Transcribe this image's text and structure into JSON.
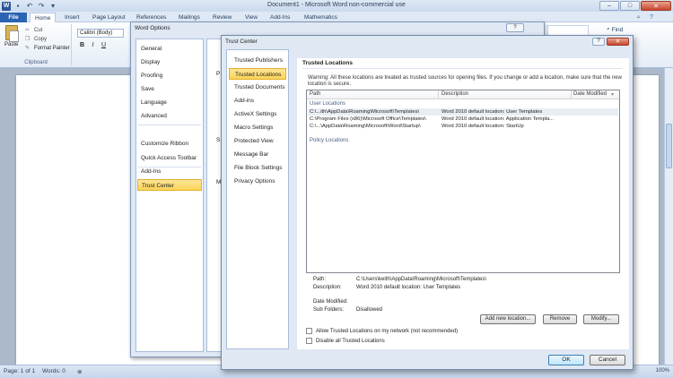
{
  "word": {
    "title": "Document1 - Microsoft Word non-commercial use",
    "tabs": [
      "File",
      "Home",
      "Insert",
      "Page Layout",
      "References",
      "Mailings",
      "Review",
      "View",
      "Add-Ins",
      "Mathematics"
    ],
    "clipboard": {
      "paste": "Paste",
      "cut": "Cut",
      "copy": "Copy",
      "format_painter": "Format Painter",
      "group": "Clipboard"
    },
    "font_name": "Calibri (Body)",
    "format_buttons": [
      "B",
      "I",
      "U"
    ],
    "find": "Find",
    "status": {
      "page": "Page: 1 of 1",
      "words": "Words: 0",
      "zoom": "100%"
    },
    "brand_color": "#2a64b2"
  },
  "word_options": {
    "title": "Word Options",
    "help": "?",
    "nav": [
      "General",
      "Display",
      "Proofing",
      "Save",
      "Language",
      "Advanced",
      "Customize Ribbon",
      "Quick Access Toolbar",
      "Add-Ins",
      "Trust Center"
    ],
    "selected": "Trust Center",
    "content_fragments": [
      "P",
      "S",
      "M"
    ]
  },
  "trust_center": {
    "title": "Trust Center",
    "help": "?",
    "close": "✕",
    "nav": [
      "Trusted Publishers",
      "Trusted Locations",
      "Trusted Documents",
      "Add-ins",
      "ActiveX Settings",
      "Macro Settings",
      "Protected View",
      "Message Bar",
      "File Block Settings",
      "Privacy Options"
    ],
    "selected": "Trusted Locations",
    "section_title": "Trusted Locations",
    "warning": "Warning: All these locations are treated as trusted sources for opening files.  If you change or add a location, make sure that the new location is secure.",
    "columns": {
      "path": "Path",
      "description": "Description",
      "date_modified": "Date Modified"
    },
    "sort_indicator": "▾",
    "user_locations_label": "User Locations",
    "user_locations": [
      {
        "path": "C:\\...ith\\AppData\\Roaming\\Microsoft\\Templates\\",
        "description": "Word 2010 default location: User Templates"
      },
      {
        "path": "C:\\Program Files (x86)\\Microsoft Office\\Templates\\",
        "description": "Word 2010 default location: Application Templa..."
      },
      {
        "path": "C:\\...\\AppData\\Roaming\\Microsoft\\Word\\Startup\\",
        "description": "Word 2010 default location: StartUp"
      }
    ],
    "policy_locations_label": "Policy Locations",
    "details": {
      "path_label": "Path:",
      "path_value": "C:\\Users\\keith\\AppData\\Roaming\\Microsoft\\Templates\\",
      "description_label": "Description:",
      "description_value": "Word 2010 default location: User Templates",
      "date_label": "Date Modified:",
      "subfolders_label": "Sub Folders:",
      "subfolders_value": "Disallowed"
    },
    "buttons": {
      "add": "Add new location...",
      "remove": "Remove",
      "modify": "Modify...",
      "ok": "OK",
      "cancel": "Cancel"
    },
    "checkboxes": {
      "allow_network": "Allow Trusted Locations on my network (not recommended)",
      "disable_all": "Disable all Trusted Locations"
    }
  }
}
